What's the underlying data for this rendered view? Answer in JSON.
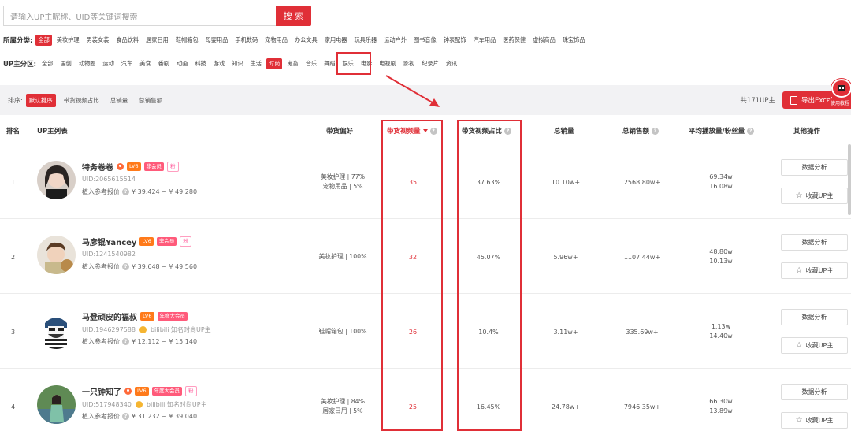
{
  "search": {
    "placeholder": "请输入UP主昵称、UID等关键词搜索",
    "button": "搜 索"
  },
  "category": {
    "label": "所属分类:",
    "items": [
      "全部",
      "美妆护理",
      "男装女装",
      "食品饮料",
      "居家日用",
      "鞋帽箱包",
      "母婴用品",
      "手机数码",
      "宠物用品",
      "办公文具",
      "家用电器",
      "玩具乐器",
      "运动户外",
      "图书音像",
      "钟表配饰",
      "汽车用品",
      "医药保健",
      "虚拟商品",
      "珠宝饰品"
    ],
    "active_index": 0
  },
  "zone": {
    "label": "UP主分区:",
    "items": [
      "全部",
      "国创",
      "动物圈",
      "运动",
      "汽车",
      "美食",
      "番剧",
      "动画",
      "科技",
      "游戏",
      "知识",
      "生活",
      "时尚",
      "鬼畜",
      "音乐",
      "舞蹈",
      "娱乐",
      "电影",
      "电视剧",
      "影视",
      "纪录片",
      "资讯"
    ],
    "active_index": 12
  },
  "sort": {
    "label": "排序:",
    "items": [
      "默认排序",
      "带货视频占比",
      "总销量",
      "总销售额"
    ],
    "active_index": 0,
    "total": "共171UP主",
    "export": "导出Excel",
    "helper": "使用教程"
  },
  "columns": {
    "rank": "排名",
    "list": "UP主列表",
    "pref": "带货偏好",
    "freq": "带货视频量",
    "ratio": "带货视频占比",
    "sales": "总销量",
    "revenue": "总销售额",
    "avg": "平均播放量/粉丝量",
    "ops": "其他操作"
  },
  "rows": [
    {
      "rank": "1",
      "name": "特务卷卷",
      "level": "LV6",
      "member": "非会员",
      "fan": "粉",
      "uid": "UID:2065615514",
      "verify": "",
      "price_label": "植入参考报价",
      "price": "¥ 39.424 ~ ¥ 49.280",
      "pref1": "美妆护理 | 77%",
      "pref2": "宠物用品 | 5%",
      "freq": "35",
      "ratio": "37.63%",
      "sales": "10.10w+",
      "revenue": "2568.80w+",
      "avg": "69.34w",
      "fans": "16.08w",
      "btn1": "数据分析",
      "btn2": "收藏UP主"
    },
    {
      "rank": "2",
      "name": "马彦锟Yancey",
      "level": "LV6",
      "member": "非会员",
      "fan": "粉",
      "uid": "UID:1241540982",
      "verify": "",
      "price_label": "植入参考报价",
      "price": "¥ 39.648 ~ ¥ 49.560",
      "pref1": "美妆护理 | 100%",
      "pref2": "",
      "freq": "32",
      "ratio": "45.07%",
      "sales": "5.96w+",
      "revenue": "1107.44w+",
      "avg": "48.80w",
      "fans": "10.13w",
      "btn1": "数据分析",
      "btn2": "收藏UP主"
    },
    {
      "rank": "3",
      "name": "马登顽皮的福叔",
      "level": "LV6",
      "member": "年度大会员",
      "fan": "",
      "uid": "UID:1946297588",
      "verify": "bilibili 知名时尚UP主",
      "price_label": "植入参考报价",
      "price": "¥ 12.112 ~ ¥ 15.140",
      "pref1": "鞋帽箱包 | 100%",
      "pref2": "",
      "freq": "26",
      "ratio": "10.4%",
      "sales": "3.11w+",
      "revenue": "335.69w+",
      "avg": "1.13w",
      "fans": "14.40w",
      "btn1": "数据分析",
      "btn2": "收藏UP主"
    },
    {
      "rank": "4",
      "name": "一只钟知了",
      "level": "LV6",
      "member": "年度大会员",
      "fan": "粉",
      "uid": "UID:517948340",
      "verify": "bilibili 知名时尚UP主",
      "price_label": "植入参考报价",
      "price": "¥ 31.232 ~ ¥ 39.040",
      "pref1": "美妆护理 | 84%",
      "pref2": "居家日用 | 5%",
      "freq": "25",
      "ratio": "16.45%",
      "sales": "24.78w+",
      "revenue": "7946.35w+",
      "avg": "66.30w",
      "fans": "13.89w",
      "btn1": "数据分析",
      "btn2": "收藏UP主"
    }
  ],
  "colors": {
    "accent": "#e02f37",
    "sortbar_bg": "#f2f2f4"
  }
}
